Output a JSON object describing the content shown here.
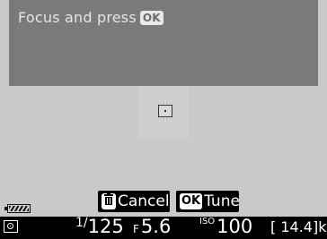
{
  "banner": {
    "message": "Focus and press",
    "ok_key": "OK"
  },
  "buttons": {
    "cancel_label": "Cancel",
    "tune_key": "OK",
    "tune_label": "Tune"
  },
  "icons": {
    "battery": "battery-icon",
    "trash": "trash-icon",
    "metering": "matrix-metering-icon",
    "focus": "focus-point-icon"
  },
  "status": {
    "shutter_numerator": "1/",
    "shutter_denominator": "125",
    "aperture_prefix": "F",
    "aperture_value": "5.6",
    "iso_label": "ISO",
    "iso_value": "100",
    "remaining": "[ 14.4]k"
  }
}
